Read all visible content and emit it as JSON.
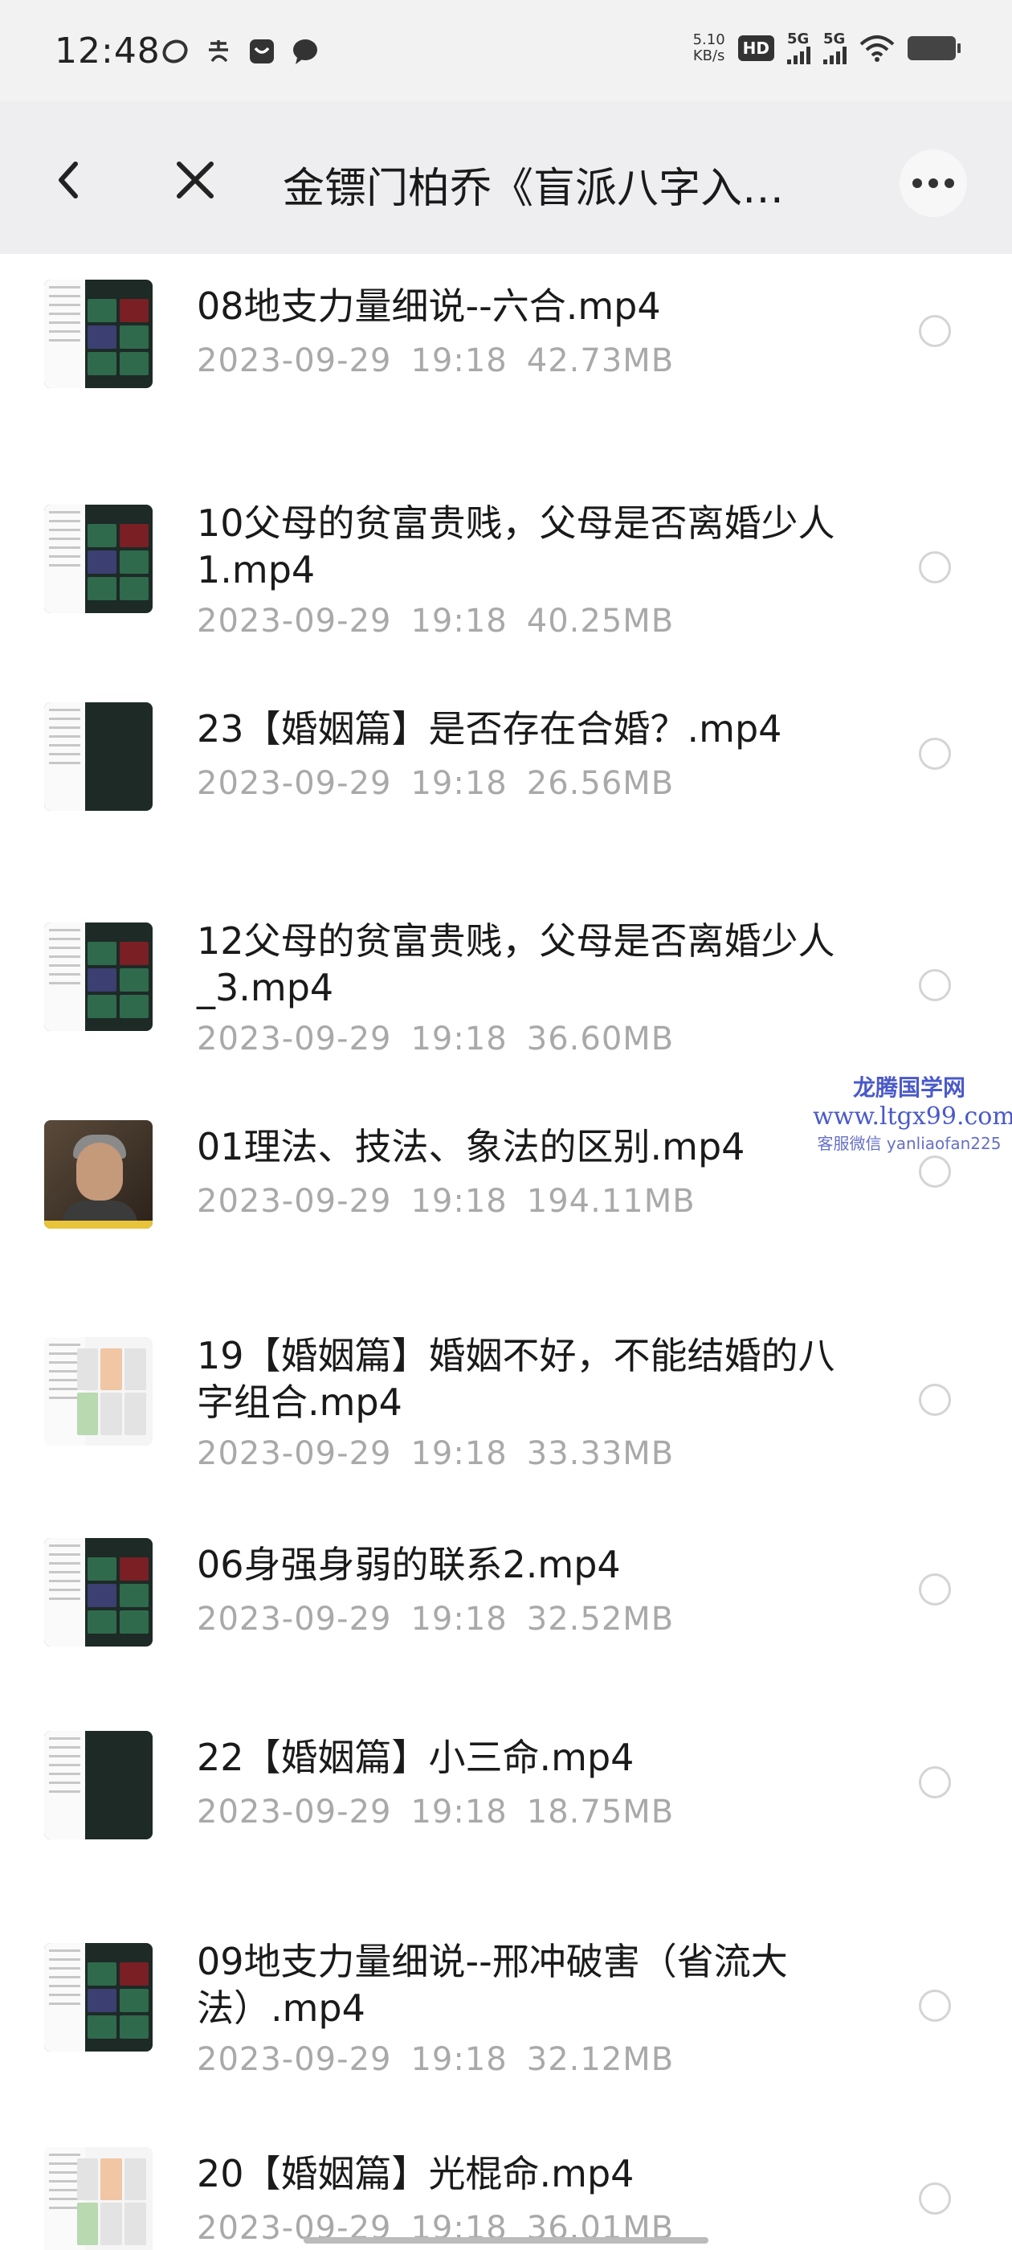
{
  "status_bar": {
    "time": "12:48",
    "net_speed_value": "5.10",
    "net_speed_unit": "KB/s",
    "hd_label": "HD",
    "signal_1": "5G",
    "signal_2": "5G",
    "icons_left": [
      "app-icon",
      "alipay-icon",
      "chat-badge-icon",
      "message-bubble-icon"
    ]
  },
  "nav": {
    "title": "金镖门柏乔《盲派八字入…",
    "back_icon": "chevron-left-icon",
    "close_icon": "close-icon",
    "more_icon": "more-dots-icon"
  },
  "files": [
    {
      "name": "08地支力量细说--六合.mp4",
      "date": "2023-09-29",
      "time": "19:18",
      "size": "42.73MB",
      "thumb": "chart"
    },
    {
      "name": "10父母的贫富贵贱，父母是否离婚少人1.mp4",
      "date": "2023-09-29",
      "time": "19:18",
      "size": "40.25MB",
      "thumb": "chart"
    },
    {
      "name": "23【婚姻篇】是否存在合婚？.mp4",
      "date": "2023-09-29",
      "time": "19:18",
      "size": "26.56MB",
      "thumb": "dark"
    },
    {
      "name": "12父母的贫富贵贱，父母是否离婚少人_3.mp4",
      "date": "2023-09-29",
      "time": "19:18",
      "size": "36.60MB",
      "thumb": "chart"
    },
    {
      "name": "01理法、技法、象法的区别.mp4",
      "date": "2023-09-29",
      "time": "19:18",
      "size": "194.11MB",
      "thumb": "photo"
    },
    {
      "name": "19【婚姻篇】婚姻不好，不能结婚的八字组合.mp4",
      "date": "2023-09-29",
      "time": "19:18",
      "size": "33.33MB",
      "thumb": "table"
    },
    {
      "name": "06身强身弱的联系2.mp4",
      "date": "2023-09-29",
      "time": "19:18",
      "size": "32.52MB",
      "thumb": "chart"
    },
    {
      "name": "22【婚姻篇】小三命.mp4",
      "date": "2023-09-29",
      "time": "19:18",
      "size": "18.75MB",
      "thumb": "dark"
    },
    {
      "name": "09地支力量细说--邢冲破害（省流大法）.mp4",
      "date": "2023-09-29",
      "time": "19:18",
      "size": "32.12MB",
      "thumb": "chart"
    },
    {
      "name": "20【婚姻篇】光棍命.mp4",
      "date": "2023-09-29",
      "time": "19:18",
      "size": "36.01MB",
      "thumb": "table"
    }
  ],
  "watermark": {
    "line1": "龙腾国学网",
    "line2": "www.ltgx99.com",
    "line3": "客服微信 yanliaofan225"
  }
}
